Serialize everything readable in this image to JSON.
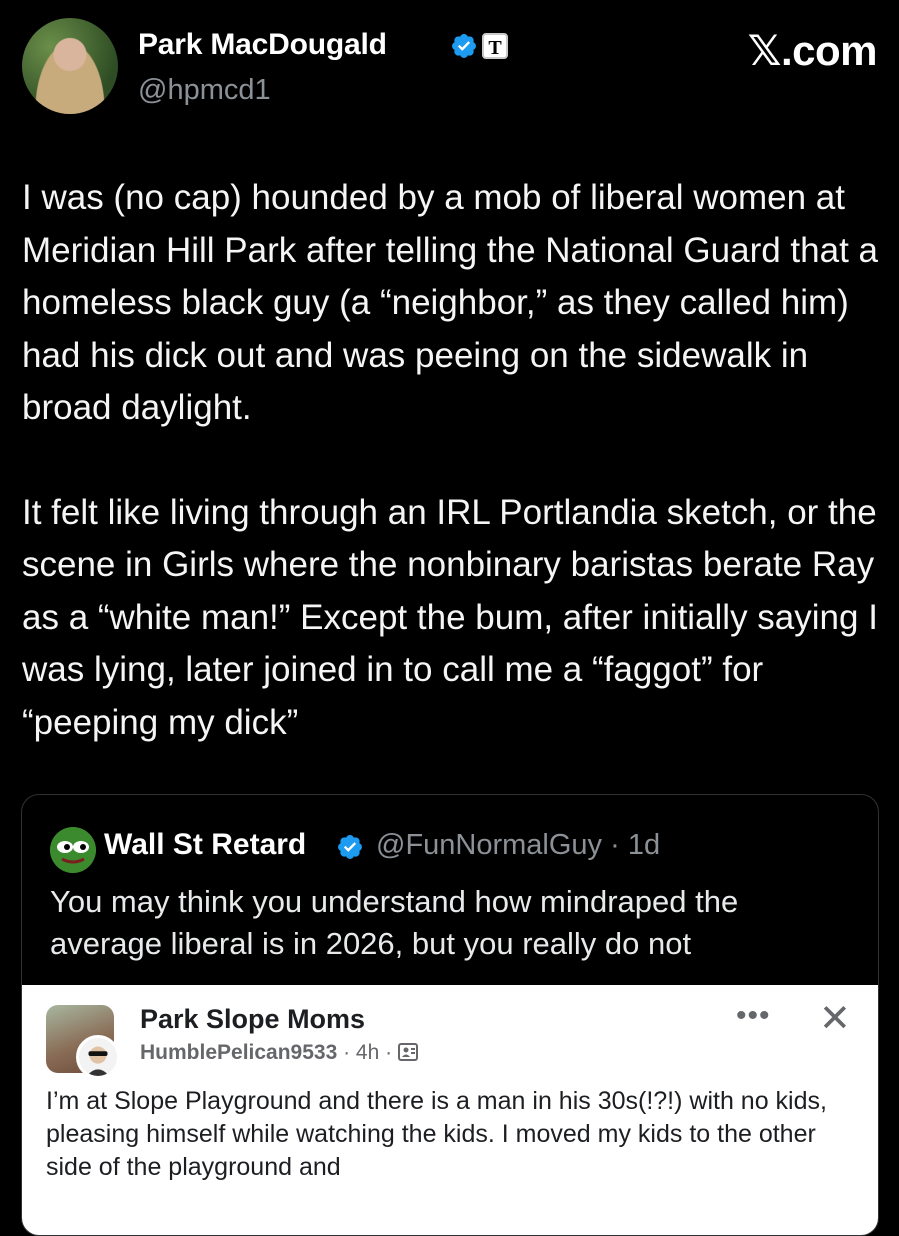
{
  "post": {
    "author": {
      "name": "Park MacDougald",
      "handle": "@hpmcd1"
    },
    "site": "𝕏.com",
    "paragraphs": [
      "I was (no cap) hounded by a mob of liberal women at Meridian Hill Park after telling the National Guard that a homeless black guy (a “neighbor,” as they called him) had his dick out and was peeing on the sidewalk in broad daylight.",
      "It felt like living through an IRL Portlandia sketch, or the scene in Girls where the nonbinary baristas berate Ray as a “white man!” Except the bum, after initially saying I was lying, later joined in to call me a “faggot” for “peeping my dick”"
    ]
  },
  "quote": {
    "name": "Wall St Retard",
    "handle": "@FunNormalGuy · 1d",
    "text": "You may think you understand how mindraped the average liberal is in 2026, but you really do not"
  },
  "fb": {
    "group": "Park Slope Moms",
    "user": "HumblePelican9533",
    "meta_time": " · 4h · ",
    "more": "•••",
    "close": "✕",
    "text": "I’m at Slope Playground and there is a man in his 30s(!?!) with no kids, pleasing himself while watching the kids. I moved my kids to the other side of the playground and"
  },
  "colors": {
    "background": "#000000",
    "verified": "#1d9bf0",
    "handle": "#8b9196"
  }
}
